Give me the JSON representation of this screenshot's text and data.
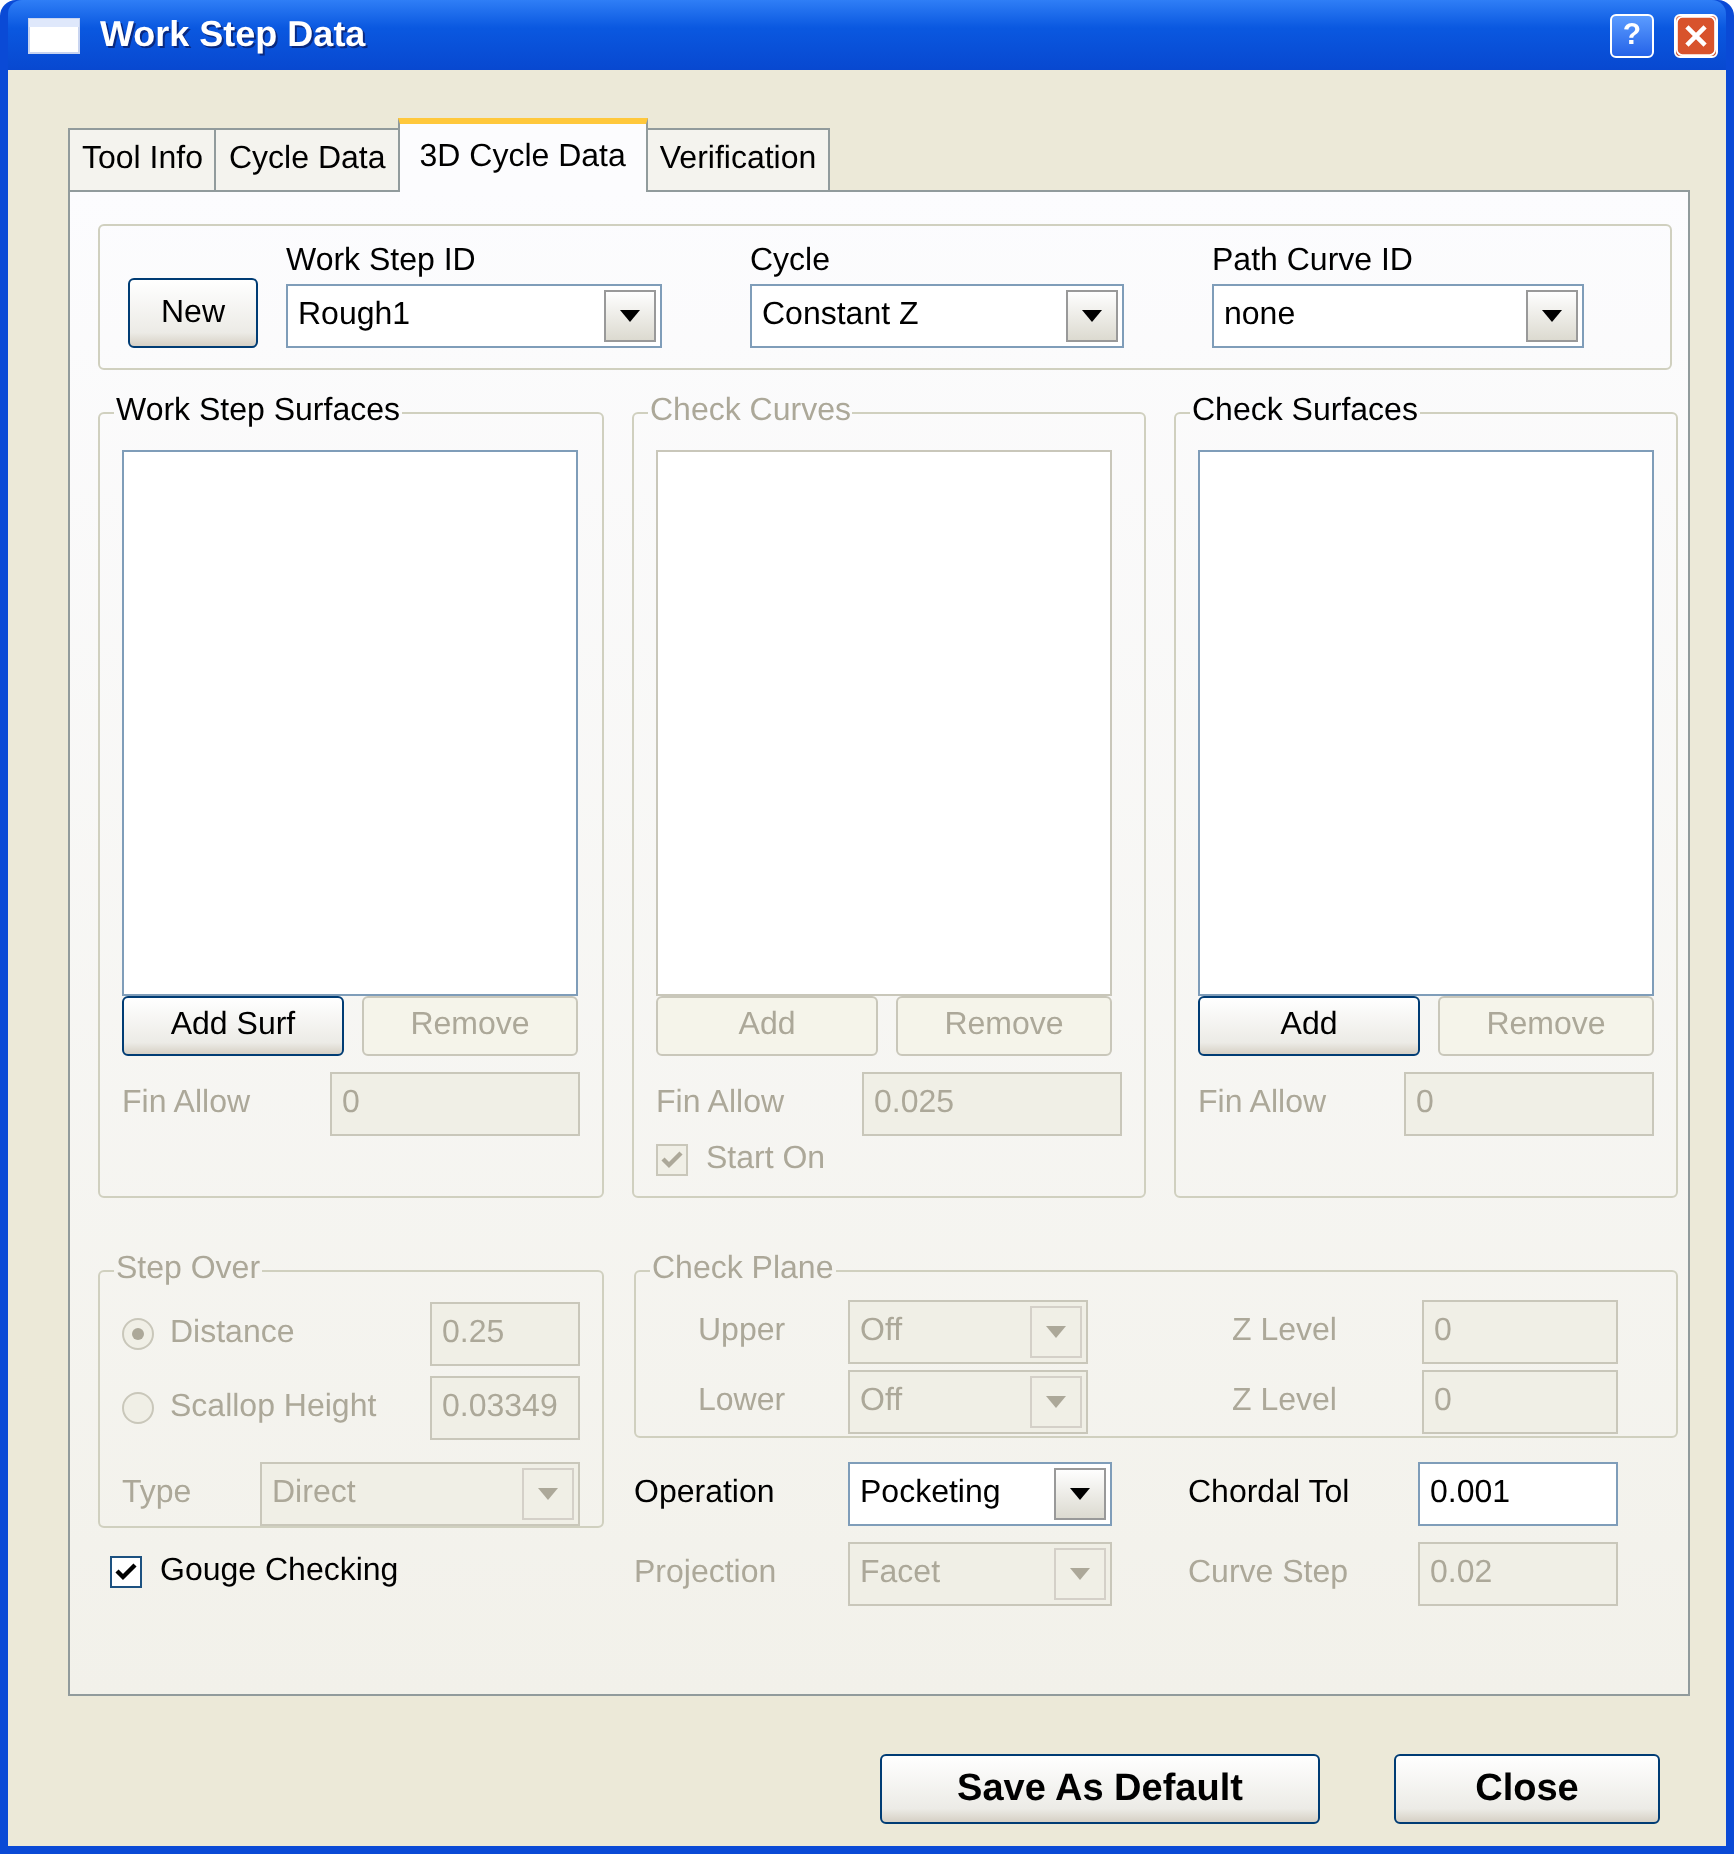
{
  "window": {
    "title": "Work Step Data",
    "help_button": "?"
  },
  "tabs": [
    {
      "label": "Tool Info",
      "selected": false
    },
    {
      "label": "Cycle Data",
      "selected": false
    },
    {
      "label": "3D Cycle Data",
      "selected": true
    },
    {
      "label": "Verification",
      "selected": false
    }
  ],
  "header": {
    "new_button": "New",
    "fields": [
      {
        "label": "Work Step ID",
        "value": "Rough1"
      },
      {
        "label": "Cycle",
        "value": "Constant Z"
      },
      {
        "label": "Path Curve ID",
        "value": "none"
      }
    ]
  },
  "groups": [
    {
      "title": "Work Step Surfaces",
      "disabled": false,
      "buttons": [
        {
          "label": "Add Surf",
          "disabled": false
        },
        {
          "label": "Remove",
          "disabled": true
        }
      ],
      "fin_allow": {
        "label": "Fin Allow",
        "value": "0",
        "disabled": true
      }
    },
    {
      "title": "Check Curves",
      "disabled": true,
      "buttons": [
        {
          "label": "Add",
          "disabled": true
        },
        {
          "label": "Remove",
          "disabled": true
        }
      ],
      "fin_allow": {
        "label": "Fin Allow",
        "value": "0.025",
        "disabled": true
      },
      "start_on": {
        "label": "Start On",
        "checked": true,
        "disabled": true
      }
    },
    {
      "title": "Check Surfaces",
      "disabled": false,
      "buttons": [
        {
          "label": "Add",
          "disabled": false
        },
        {
          "label": "Remove",
          "disabled": true
        }
      ],
      "fin_allow": {
        "label": "Fin Allow",
        "value": "0",
        "disabled": true
      }
    }
  ],
  "step_over": {
    "title": "Step Over",
    "disabled": true,
    "options": [
      {
        "label": "Distance",
        "value": "0.25",
        "selected": true
      },
      {
        "label": "Scallop Height",
        "value": "0.03349",
        "selected": false
      }
    ],
    "type": {
      "label": "Type",
      "value": "Direct"
    }
  },
  "check_plane": {
    "title": "Check Plane",
    "disabled": true,
    "rows": [
      {
        "label": "Upper",
        "value": "Off",
        "z_label": "Z Level",
        "z_value": "0"
      },
      {
        "label": "Lower",
        "value": "Off",
        "z_label": "Z Level",
        "z_value": "0"
      }
    ]
  },
  "gouge_checking": {
    "label": "Gouge Checking",
    "checked": true
  },
  "operation": {
    "label": "Operation",
    "value": "Pocketing",
    "disabled": false
  },
  "projection": {
    "label": "Projection",
    "value": "Facet",
    "disabled": true
  },
  "chordal_tol": {
    "label": "Chordal Tol",
    "value": "0.001",
    "disabled": false
  },
  "curve_step": {
    "label": "Curve Step",
    "value": "0.02",
    "disabled": true
  },
  "footer_buttons": [
    {
      "label": "Save As Default"
    },
    {
      "label": "Close"
    }
  ]
}
